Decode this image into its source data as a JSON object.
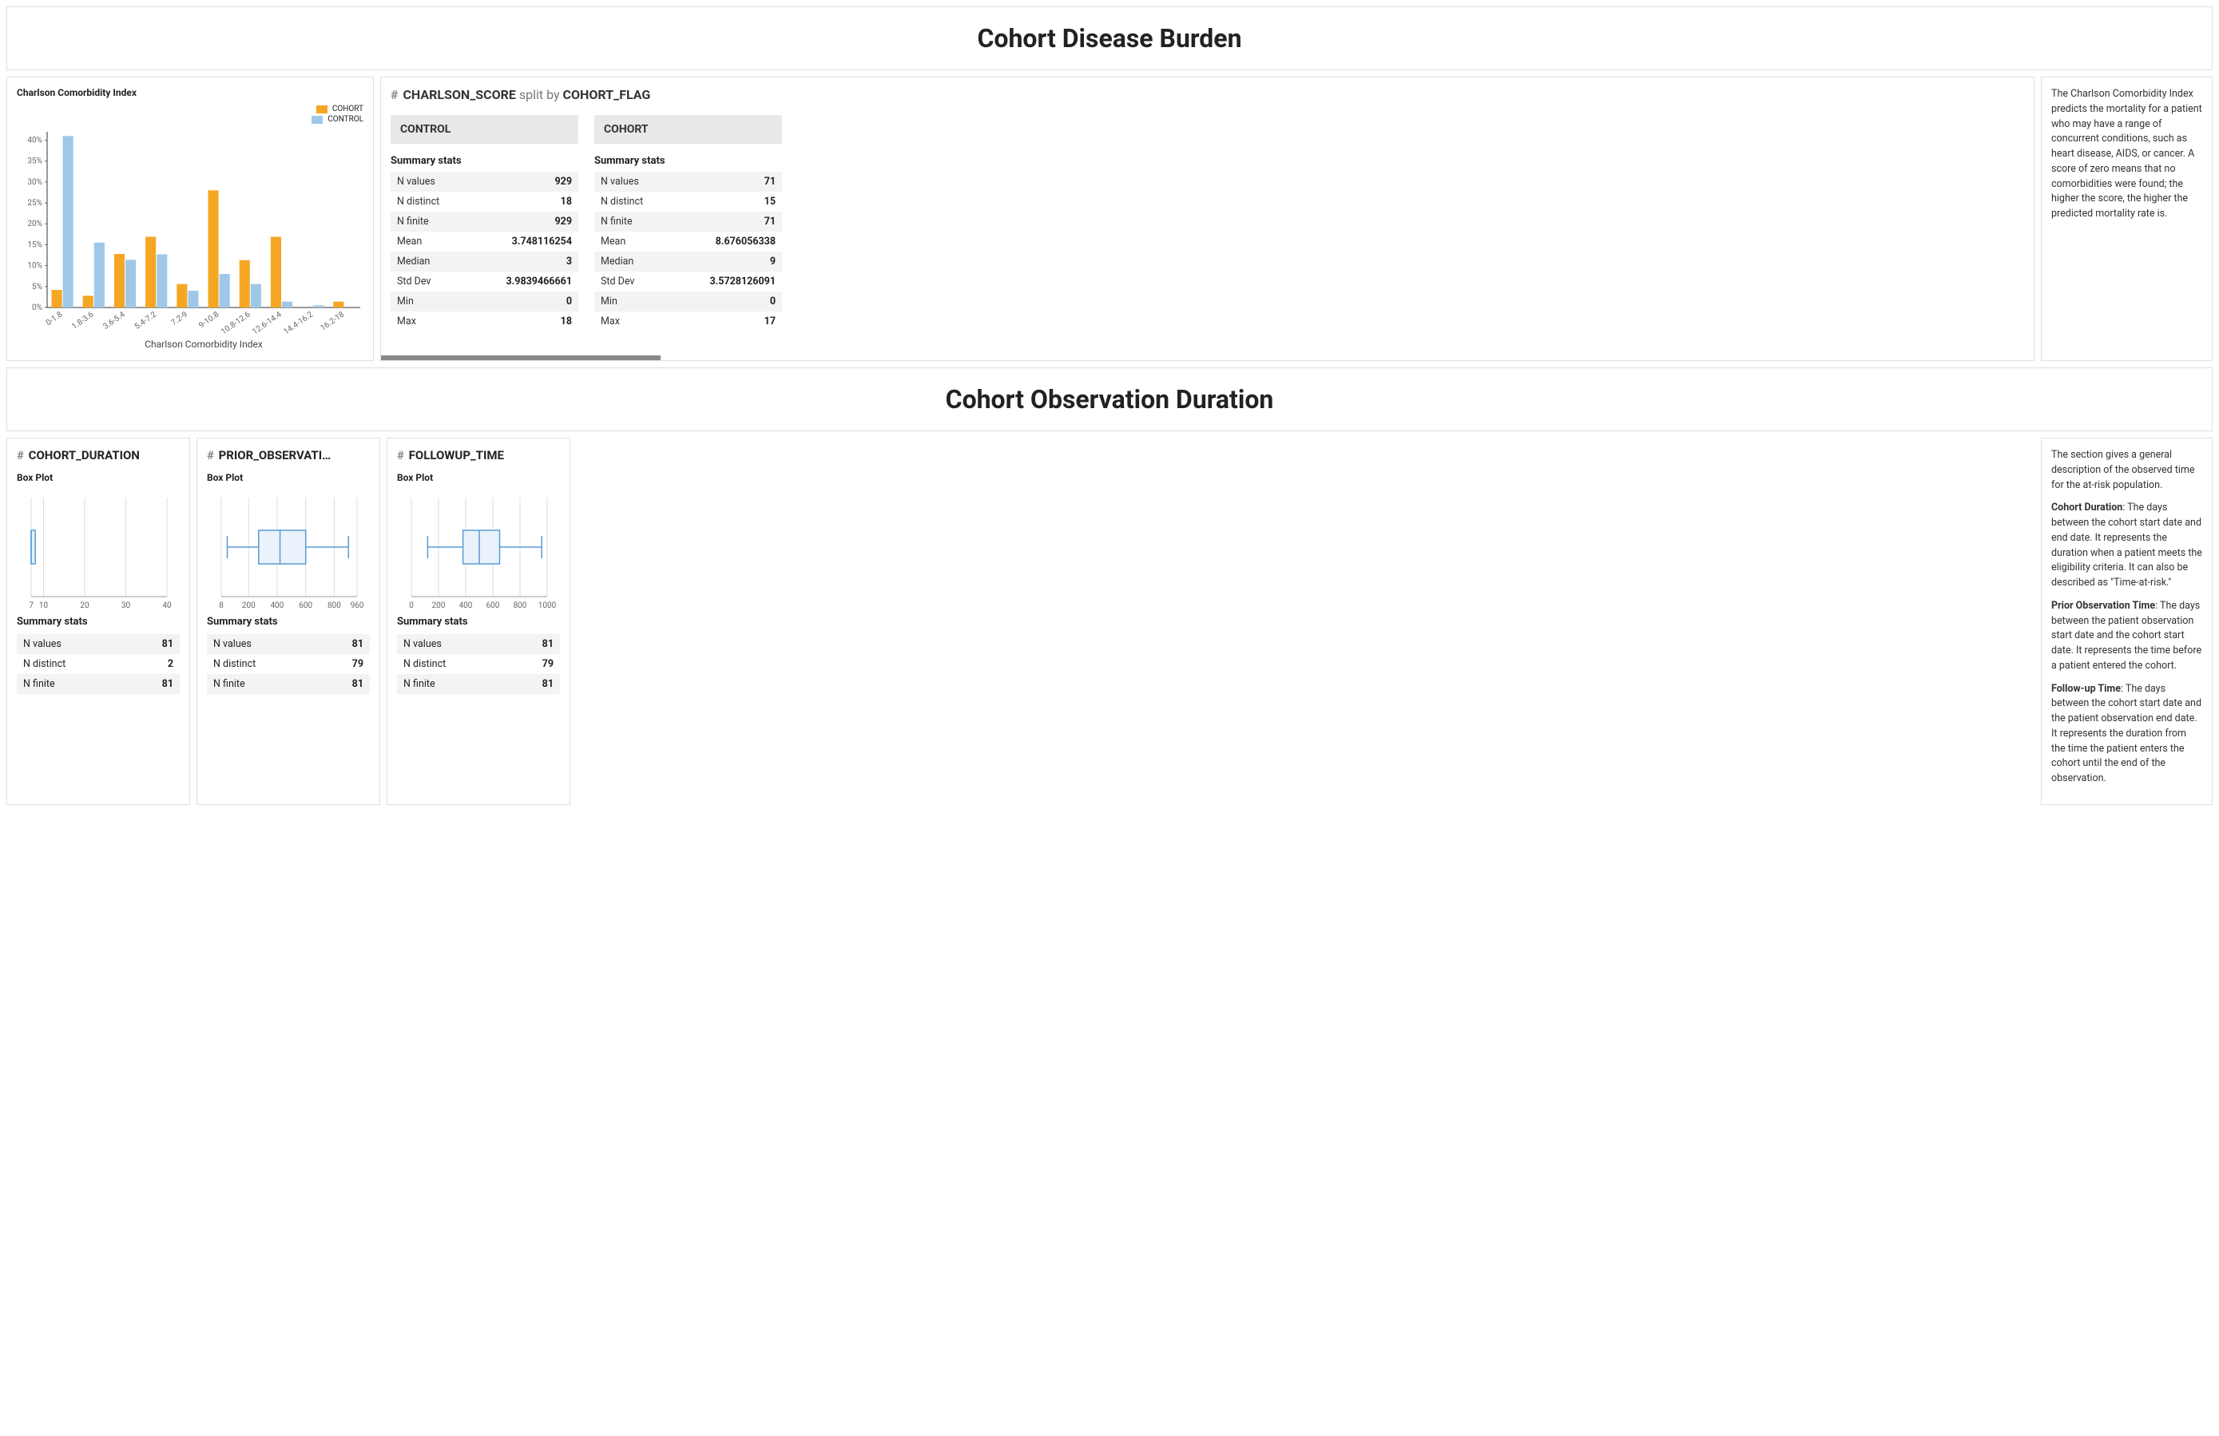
{
  "section1": {
    "title": "Cohort Disease Burden"
  },
  "section2": {
    "title": "Cohort Observation Duration"
  },
  "charlson": {
    "chart_title": "Charlson Comorbidity Index",
    "xlabel": "Charlson Comorbidity Index",
    "legend": {
      "cohort": "COHORT",
      "control": "CONTROL"
    },
    "colors": {
      "cohort": "#f5a623",
      "control": "#9fc8e8"
    }
  },
  "split_header": {
    "hash": "#",
    "var": "CHARLSON_SCORE",
    "split_text": "split by",
    "by": "COHORT_FLAG"
  },
  "summary_label": "Summary stats",
  "groups": {
    "control": {
      "name": "CONTROL",
      "rows": [
        {
          "k": "N values",
          "v": "929"
        },
        {
          "k": "N distinct",
          "v": "18"
        },
        {
          "k": "N finite",
          "v": "929"
        },
        {
          "k": "Mean",
          "v": "3.748116254"
        },
        {
          "k": "Median",
          "v": "3"
        },
        {
          "k": "Std Dev",
          "v": "3.9839466661"
        },
        {
          "k": "Min",
          "v": "0"
        },
        {
          "k": "Max",
          "v": "18"
        }
      ]
    },
    "cohort": {
      "name": "COHORT",
      "rows": [
        {
          "k": "N values",
          "v": "71"
        },
        {
          "k": "N distinct",
          "v": "15"
        },
        {
          "k": "N finite",
          "v": "71"
        },
        {
          "k": "Mean",
          "v": "8.676056338"
        },
        {
          "k": "Median",
          "v": "9"
        },
        {
          "k": "Std Dev",
          "v": "3.5728126091"
        },
        {
          "k": "Min",
          "v": "0"
        },
        {
          "k": "Max",
          "v": "17"
        }
      ]
    }
  },
  "charlson_desc": "The Charlson Comorbidity Index predicts the mortality for a patient who may have a range of concurrent conditions, such as heart disease, AIDS, or cancer. A score of zero means that no comorbidities were found; the higher the score, the higher the predicted mortality rate is.",
  "box_plot_label": "Box Plot",
  "duration_cards": [
    {
      "var": "COHORT_DURATION",
      "ticks": [
        "7",
        "10",
        "20",
        "30",
        "40"
      ],
      "rows": [
        {
          "k": "N values",
          "v": "81"
        },
        {
          "k": "N distinct",
          "v": "2"
        },
        {
          "k": "N finite",
          "v": "81"
        }
      ]
    },
    {
      "var": "PRIOR_OBSERVATI…",
      "ticks": [
        "8",
        "200",
        "400",
        "600",
        "800",
        "960"
      ],
      "rows": [
        {
          "k": "N values",
          "v": "81"
        },
        {
          "k": "N distinct",
          "v": "79"
        },
        {
          "k": "N finite",
          "v": "81"
        }
      ]
    },
    {
      "var": "FOLLOWUP_TIME",
      "ticks": [
        "0",
        "200",
        "400",
        "600",
        "800",
        "1000"
      ],
      "rows": [
        {
          "k": "N values",
          "v": "81"
        },
        {
          "k": "N distinct",
          "v": "79"
        },
        {
          "k": "N finite",
          "v": "81"
        }
      ]
    }
  ],
  "duration_desc": {
    "intro": "The section gives a general description of the observed time for the at-risk population.",
    "cohort_label": "Cohort Duration",
    "cohort_text": ": The days between the cohort start date and end date. It represents the duration when a patient meets the eligibility criteria. It can also be described as \"Time-at-risk.\"",
    "prior_label": "Prior Observation Time",
    "prior_text": ": The days between the patient observation start date and the cohort start date. It represents the time before a patient entered the cohort.",
    "followup_label": "Follow-up Time",
    "followup_text": ": The days between the cohort start date and the patient observation end date. It represents the duration from the time the patient enters the cohort until the end of the observation."
  },
  "chart_data": [
    {
      "type": "bar",
      "title": "Charlson Comorbidity Index",
      "xlabel": "Charlson Comorbidity Index",
      "ylabel": "Percent",
      "ylim": [
        0,
        42
      ],
      "categories": [
        "0-1.8",
        "1.8-3.6",
        "3.6-5.4",
        "5.4-7.2",
        "7.2-9",
        "9-10.8",
        "10.8-12.6",
        "12.6-14.4",
        "14.4-16.2",
        "16.2-18"
      ],
      "series": [
        {
          "name": "COHORT",
          "color": "#f5a623",
          "values": [
            4.2,
            2.8,
            12.8,
            16.9,
            5.6,
            28.0,
            11.3,
            16.9,
            0.0,
            1.4
          ]
        },
        {
          "name": "CONTROL",
          "color": "#9fc8e8",
          "values": [
            41.0,
            15.5,
            11.4,
            12.7,
            4.0,
            8.0,
            5.6,
            1.4,
            0.5,
            0.0
          ]
        }
      ]
    },
    {
      "type": "boxplot",
      "title": "COHORT_DURATION",
      "xlim": [
        7,
        40
      ],
      "whisker_low": 7,
      "q1": 7,
      "median": 7,
      "q3": 8,
      "whisker_high": 8
    },
    {
      "type": "boxplot",
      "title": "PRIOR_OBSERVATION",
      "xlim": [
        8,
        960
      ],
      "whisker_low": 50,
      "q1": 270,
      "median": 420,
      "q3": 600,
      "whisker_high": 900
    },
    {
      "type": "boxplot",
      "title": "FOLLOWUP_TIME",
      "xlim": [
        0,
        1000
      ],
      "whisker_low": 120,
      "q1": 380,
      "median": 500,
      "q3": 650,
      "whisker_high": 960
    }
  ]
}
